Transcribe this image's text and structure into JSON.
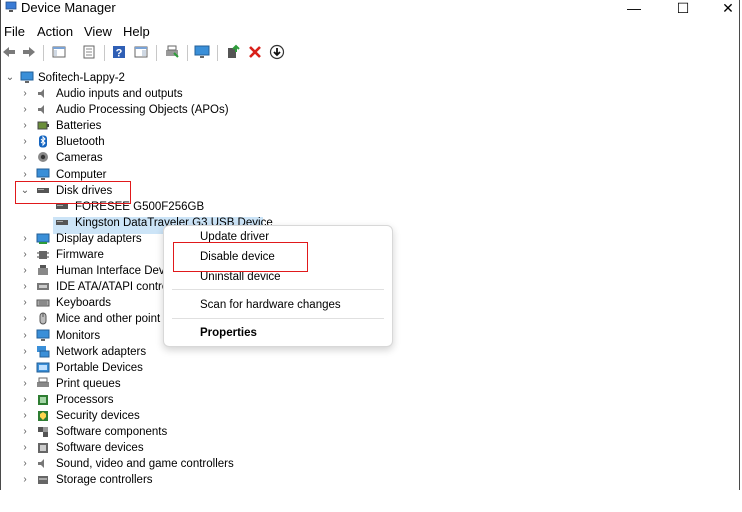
{
  "window": {
    "title": "Device Manager"
  },
  "titlebar_buttons": {
    "minimize": "—",
    "maximize": "☐",
    "close": "✕"
  },
  "menu": [
    "File",
    "Action",
    "View",
    "Help"
  ],
  "tree": {
    "root": "Sofitech-Lappy-2",
    "categories": [
      {
        "label": "Audio inputs and outputs",
        "icon": "speaker-icon"
      },
      {
        "label": "Audio Processing Objects (APOs)",
        "icon": "speaker-icon"
      },
      {
        "label": "Batteries",
        "icon": "battery-icon"
      },
      {
        "label": "Bluetooth",
        "icon": "bluetooth-icon"
      },
      {
        "label": "Cameras",
        "icon": "camera-icon"
      },
      {
        "label": "Computer",
        "icon": "monitor-icon"
      },
      {
        "label": "Disk drives",
        "icon": "disk-drive-icon"
      },
      {
        "label": "Display adapters",
        "icon": "display-adapter-icon"
      },
      {
        "label": "Firmware",
        "icon": "chip-icon"
      },
      {
        "label": "Human Interface Dev",
        "icon": "hid-icon"
      },
      {
        "label": "IDE ATA/ATAPI control",
        "icon": "ide-icon"
      },
      {
        "label": "Keyboards",
        "icon": "keyboard-icon"
      },
      {
        "label": "Mice and other point",
        "icon": "mouse-icon"
      },
      {
        "label": "Monitors",
        "icon": "monitor-icon"
      },
      {
        "label": "Network adapters",
        "icon": "network-icon"
      },
      {
        "label": "Portable Devices",
        "icon": "portable-device-icon"
      },
      {
        "label": "Print queues",
        "icon": "printer-icon"
      },
      {
        "label": "Processors",
        "icon": "processor-icon"
      },
      {
        "label": "Security devices",
        "icon": "security-icon"
      },
      {
        "label": "Software components",
        "icon": "software-component-icon"
      },
      {
        "label": "Software devices",
        "icon": "software-device-icon"
      },
      {
        "label": "Sound, video and game controllers",
        "icon": "speaker-icon"
      },
      {
        "label": "Storage controllers",
        "icon": "storage-icon"
      }
    ],
    "disk_children": [
      "FORESEE G500F256GB",
      "Kingston DataTraveler G3 USB Device"
    ]
  },
  "context_menu": {
    "items": [
      "Update driver",
      "Disable device",
      "Uninstall device",
      "Scan for hardware changes",
      "Properties"
    ]
  },
  "colors": {
    "selection": "#cce4f7",
    "highlight_box": "#e0191b"
  }
}
